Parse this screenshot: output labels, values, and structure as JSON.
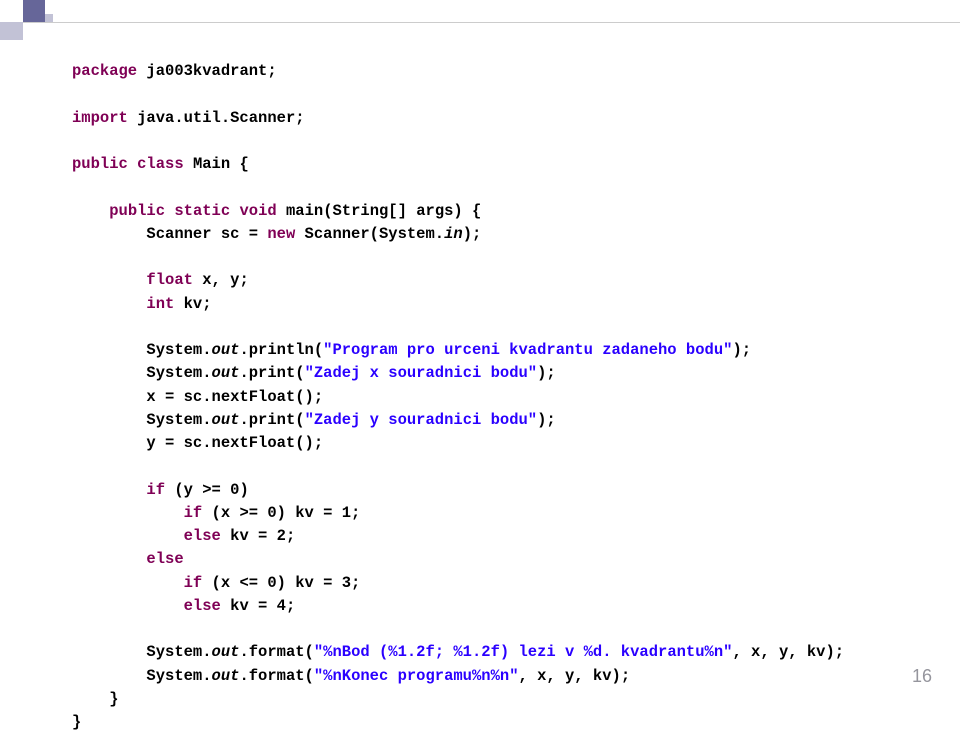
{
  "code": {
    "l1_kw1": "package",
    "l1_t": " ja003kvadrant;",
    "l3_kw1": "import",
    "l3_t": " java.util.Scanner;",
    "l5_kw1": "public",
    "l5_kw2": "class",
    "l5_t": " Main {",
    "l7_kw1": "public",
    "l7_kw2": "static",
    "l7_kw3": "void",
    "l7_t": " main(String[] args) {",
    "l8_p1": "        Scanner sc = ",
    "l8_kw1": "new",
    "l8_p2": " Scanner(System.",
    "l8_it": "in",
    "l8_p3": ");",
    "l10_kw1": "float",
    "l10_t": " x, y;",
    "l11_kw1": "int",
    "l11_t": " kv;",
    "l13_p1": "        System.",
    "l13_it": "out",
    "l13_p2": ".println(",
    "l13_s": "\"Program pro urceni kvadrantu zadaneho bodu\"",
    "l13_p3": ");",
    "l14_p1": "        System.",
    "l14_it": "out",
    "l14_p2": ".print(",
    "l14_s": "\"Zadej x souradnici bodu\"",
    "l14_p3": ");",
    "l15_t": "        x = sc.nextFloat();",
    "l16_p1": "        System.",
    "l16_it": "out",
    "l16_p2": ".print(",
    "l16_s": "\"Zadej y souradnici bodu\"",
    "l16_p3": ");",
    "l17_t": "        y = sc.nextFloat();",
    "l19_kw1": "if",
    "l19_t": " (y >= 0)",
    "l20_kw1": "if",
    "l20_t": " (x >= 0) kv = 1;",
    "l21_kw1": "else",
    "l21_t": " kv = 2;",
    "l22_kw1": "else",
    "l23_kw1": "if",
    "l23_t": " (x <= 0) kv = 3;",
    "l24_kw1": "else",
    "l24_t": " kv = 4;",
    "l26_p1": "        System.",
    "l26_it": "out",
    "l26_p2": ".format(",
    "l26_s": "\"%nBod (%1.2f; %1.2f) lezi v %d. kvadrantu%n\"",
    "l26_p3": ", x, y, kv);",
    "l27_p1": "        System.",
    "l27_it": "out",
    "l27_p2": ".format(",
    "l27_s": "\"%nKonec programu%n%n\"",
    "l27_p3": ", x, y, kv);",
    "l28_t": "    }",
    "l29_t": "}"
  },
  "page_number": "16"
}
